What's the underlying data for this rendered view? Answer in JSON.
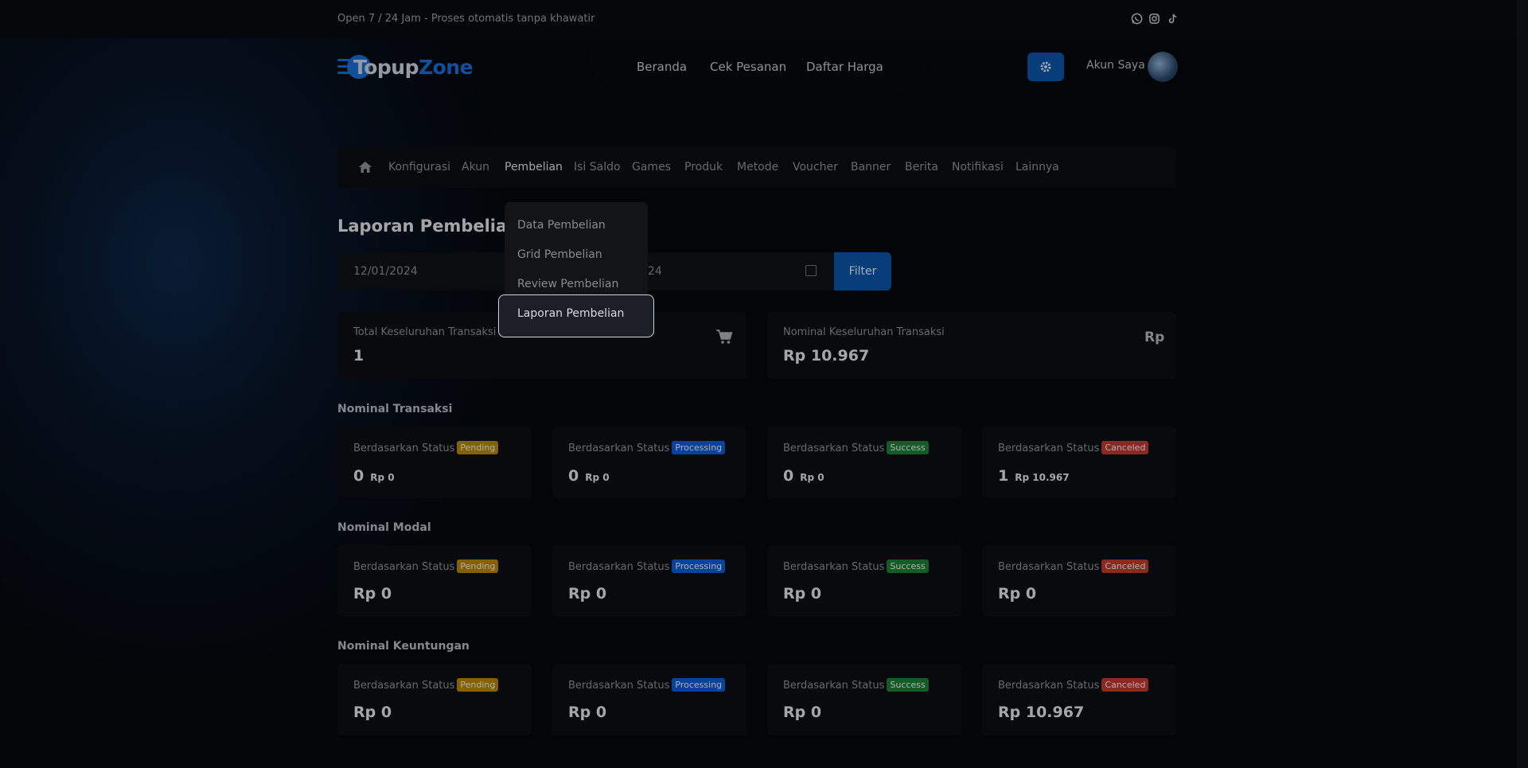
{
  "topbar": {
    "text": "Open 7 / 24 Jam - Proses otomatis tanpa khawatir",
    "icons": [
      "whatsapp-icon",
      "instagram-icon",
      "tiktok-icon"
    ]
  },
  "logo": {
    "part1": "Topup",
    "part2": "Zone"
  },
  "nav": {
    "links": [
      "Beranda",
      "Cek Pesanan",
      "Daftar Harga"
    ]
  },
  "account": {
    "label": "Akun Saya"
  },
  "menu": {
    "items": [
      "Konfigurasi",
      "Akun",
      "Pembelian",
      "Isi Saldo",
      "Games",
      "Produk",
      "Metode",
      "Voucher",
      "Banner",
      "Berita",
      "Notifikasi",
      "Lainnya"
    ],
    "active": "Pembelian"
  },
  "dropdown": {
    "items": [
      "Data Pembelian",
      "Grid Pembelian",
      "Review Pembelian",
      "Laporan Pembelian"
    ],
    "hovered": "Laporan Pembelian"
  },
  "page": {
    "title": "Laporan Pembelian"
  },
  "filter": {
    "start_date": "12/01/2024",
    "end_date_visible": "24",
    "button": "Filter"
  },
  "summary": {
    "total_label": "Total Keseluruhan Transaksi",
    "total_value": "1",
    "nominal_label": "Nominal Keseluruhan Transaksi",
    "nominal_value": "Rp 10.967",
    "rp_icon": "Rp"
  },
  "status_label": "Berdasarkan Status",
  "badges": {
    "pending": {
      "text": "Pending",
      "color": "#b8860b"
    },
    "processing": {
      "text": "Processing",
      "color": "#0b5ed7"
    },
    "success": {
      "text": "Success",
      "color": "#1e7e34"
    },
    "canceled": {
      "text": "Canceled",
      "color": "#c0392b"
    }
  },
  "sections": {
    "transaksi": {
      "title": "Nominal Transaksi",
      "cards": [
        {
          "count": "0",
          "amount": "Rp 0"
        },
        {
          "count": "0",
          "amount": "Rp 0"
        },
        {
          "count": "0",
          "amount": "Rp 0"
        },
        {
          "count": "1",
          "amount": "Rp 10.967"
        }
      ]
    },
    "modal": {
      "title": "Nominal Modal",
      "cards": [
        {
          "amount": "Rp 0"
        },
        {
          "amount": "Rp 0"
        },
        {
          "amount": "Rp 0"
        },
        {
          "amount": "Rp 0"
        }
      ]
    },
    "keuntungan": {
      "title": "Nominal Keuntungan",
      "cards": [
        {
          "amount": "Rp 0"
        },
        {
          "amount": "Rp 0"
        },
        {
          "amount": "Rp 0"
        },
        {
          "amount": "Rp 10.967"
        }
      ]
    }
  }
}
